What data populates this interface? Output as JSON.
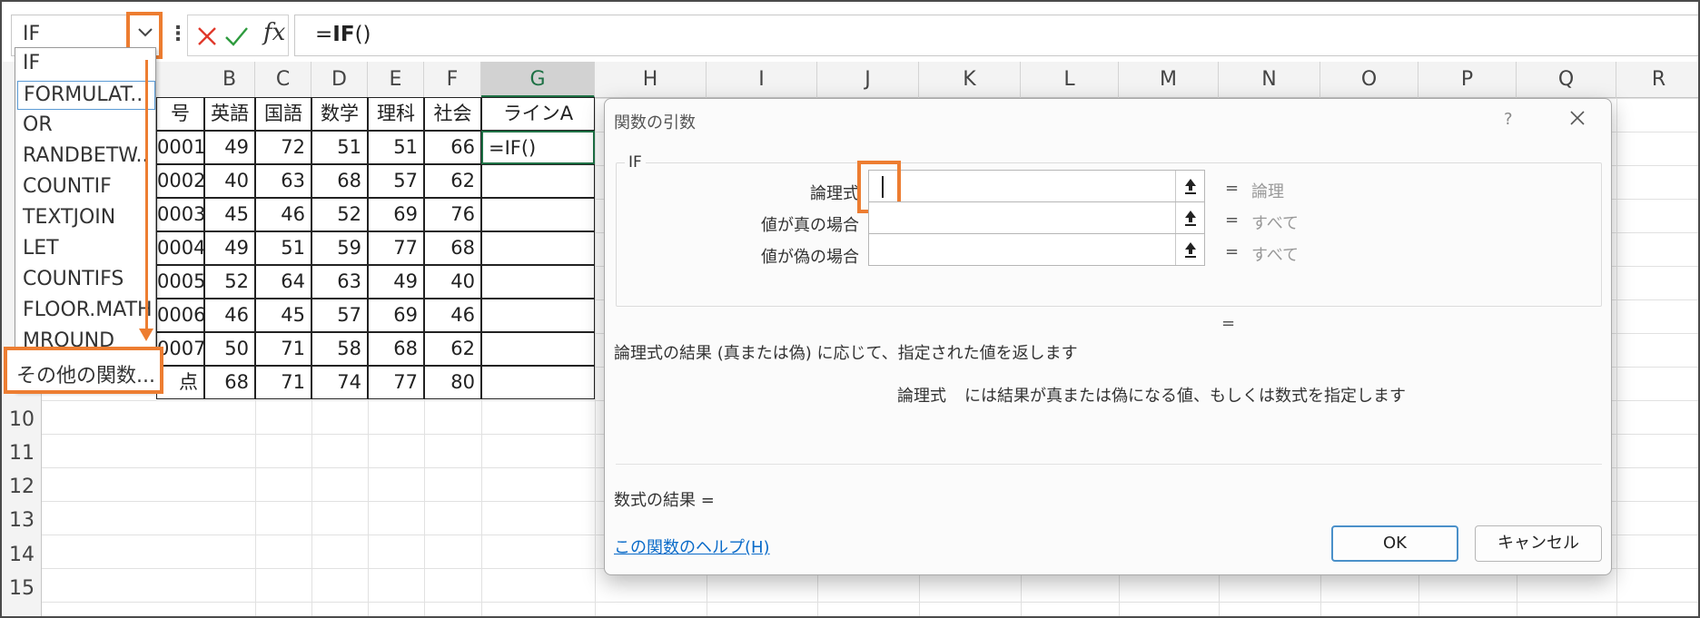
{
  "namebox": {
    "value": "IF"
  },
  "formula_bar": {
    "prefix": "=",
    "func": "IF",
    "suffix": "()",
    "fx_label": "fx"
  },
  "columns": [
    "B",
    "C",
    "D",
    "E",
    "F",
    "G",
    "H",
    "I",
    "J",
    "K",
    "L",
    "M",
    "N",
    "O",
    "P",
    "Q",
    "R"
  ],
  "row_numbers": [
    "10",
    "11",
    "12",
    "13",
    "14",
    "15"
  ],
  "table": {
    "header_partial": "号",
    "headers": [
      "英語",
      "国語",
      "数学",
      "理科",
      "社会",
      "ラインA"
    ],
    "rows": [
      {
        "id": "0001",
        "vals": [
          "49",
          "72",
          "51",
          "51",
          "66"
        ],
        "g": "=IF()"
      },
      {
        "id": "0002",
        "vals": [
          "40",
          "63",
          "68",
          "57",
          "62"
        ],
        "g": ""
      },
      {
        "id": "0003",
        "vals": [
          "45",
          "46",
          "52",
          "69",
          "76"
        ],
        "g": ""
      },
      {
        "id": "0004",
        "vals": [
          "49",
          "51",
          "59",
          "77",
          "68"
        ],
        "g": ""
      },
      {
        "id": "0005",
        "vals": [
          "52",
          "64",
          "63",
          "49",
          "40"
        ],
        "g": ""
      },
      {
        "id": "0006",
        "vals": [
          "46",
          "45",
          "57",
          "69",
          "46"
        ],
        "g": ""
      },
      {
        "id": "0007",
        "vals": [
          "50",
          "71",
          "58",
          "68",
          "62"
        ],
        "g": ""
      },
      {
        "id": "点",
        "vals": [
          "68",
          "71",
          "74",
          "77",
          "80"
        ],
        "g": ""
      }
    ]
  },
  "dropdown": {
    "items": [
      "IF",
      "FORMULAT..",
      "OR",
      "RANDBETW..",
      "COUNTIF",
      "TEXTJOIN",
      "LET",
      "COUNTIFS",
      "FLOOR.MATH",
      "MROUND"
    ],
    "selected_index": 1,
    "more": "その他の関数..."
  },
  "dialog": {
    "title": "関数の引数",
    "help": "?",
    "function_name": "IF",
    "args": [
      {
        "label": "論理式",
        "eq": "=",
        "value": "論理"
      },
      {
        "label": "値が真の場合",
        "eq": "=",
        "value": "すべて"
      },
      {
        "label": "値が偽の場合",
        "eq": "=",
        "value": "すべて"
      }
    ],
    "result_eq": "=",
    "description": "論理式の結果 (真または偽) に応じて、指定された値を返します",
    "arg_desc_name": "論理式",
    "arg_desc_text": "には結果が真または偽になる値、もしくは数式を指定します",
    "formula_result": "数式の結果 =",
    "help_link": "この関数のヘルプ(H)",
    "ok": "OK",
    "cancel": "キャンセル"
  },
  "colors": {
    "highlight": "#ed7d31",
    "excel_green": "#1e7145",
    "link": "#0a6bc9"
  }
}
